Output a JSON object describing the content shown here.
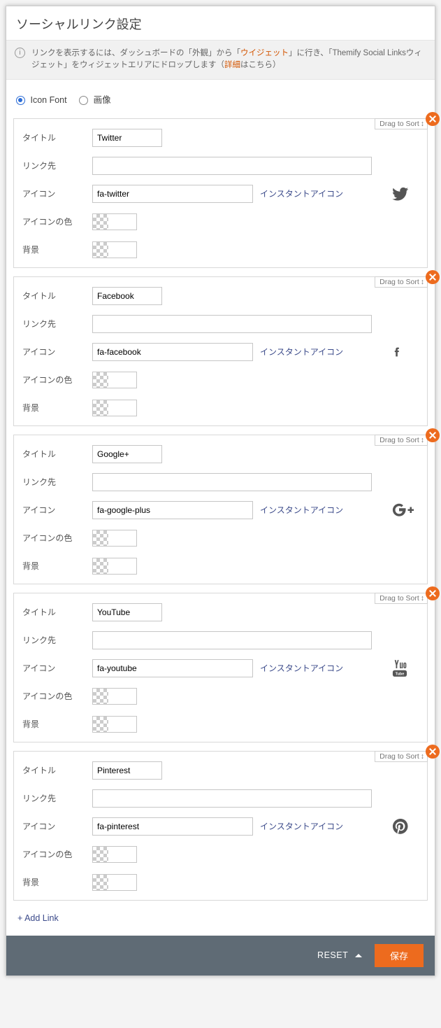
{
  "panel_title": "ソーシャルリンク設定",
  "info": {
    "prefix": "リンクを表示するには、ダッシュボードの「外観」から「",
    "widget": "ウイジェット",
    "mid": "」に行き、「Themify Social Linksウィジェット」をウィジェットエリアにドロップします（",
    "detail_link": "詳細",
    "suffix": "はこちら）"
  },
  "radio": {
    "icon_font": "Icon Font",
    "image": "画像"
  },
  "labels": {
    "title": "タイトル",
    "link": "リンク先",
    "icon": "アイコン",
    "icon_color": "アイコンの色",
    "background": "背景"
  },
  "instant_icon": "インスタントアイコン",
  "drag_to_sort": "Drag to Sort",
  "links": [
    {
      "title": "Twitter",
      "url": "",
      "icon": "fa-twitter",
      "glyph": "twitter"
    },
    {
      "title": "Facebook",
      "url": "",
      "icon": "fa-facebook",
      "glyph": "facebook"
    },
    {
      "title": "Google+",
      "url": "",
      "icon": "fa-google-plus",
      "glyph": "googleplus"
    },
    {
      "title": "YouTube",
      "url": "",
      "icon": "fa-youtube",
      "glyph": "youtube"
    },
    {
      "title": "Pinterest",
      "url": "",
      "icon": "fa-pinterest",
      "glyph": "pinterest"
    }
  ],
  "add_link": "+ Add Link",
  "footer": {
    "reset": "RESET",
    "save": "保存"
  }
}
